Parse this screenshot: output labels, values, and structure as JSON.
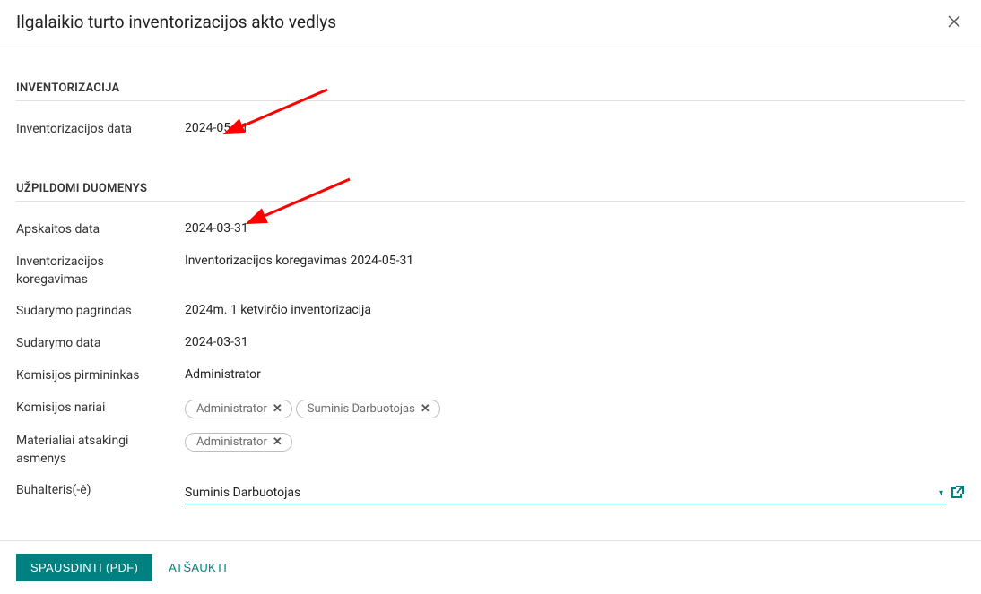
{
  "dialog": {
    "title": "Ilgalaikio turto inventorizacijos akto vedlys"
  },
  "sections": {
    "inventory": {
      "heading": "INVENTORIZACIJA",
      "date_label": "Inventorizacijos data",
      "date_value": "2024-05-31"
    },
    "filled": {
      "heading": "UŽPILDOMI DUOMENYS",
      "accounting_date_label": "Apskaitos data",
      "accounting_date_value": "2024-03-31",
      "correction_label": "Inventorizacijos koregavimas",
      "correction_value": "Inventorizacijos koregavimas 2024-05-31",
      "basis_label": "Sudarymo pagrindas",
      "basis_value": "2024m. 1 ketvirčio inventorizacija",
      "creation_date_label": "Sudarymo data",
      "creation_date_value": "2024-03-31",
      "chair_label": "Komisijos pirmininkas",
      "chair_value": "Administrator",
      "members_label": "Komisijos nariai",
      "members": [
        "Administrator",
        "Suminis Darbuotojas"
      ],
      "responsible_label": "Materialiai atsakingi asmenys",
      "responsible": [
        "Administrator"
      ],
      "accountant_label": "Buhalteris(-ė)",
      "accountant_value": "Suminis Darbuotojas"
    }
  },
  "footer": {
    "print_label": "SPAUSDINTI (PDF)",
    "cancel_label": "ATŠAUKTI"
  }
}
